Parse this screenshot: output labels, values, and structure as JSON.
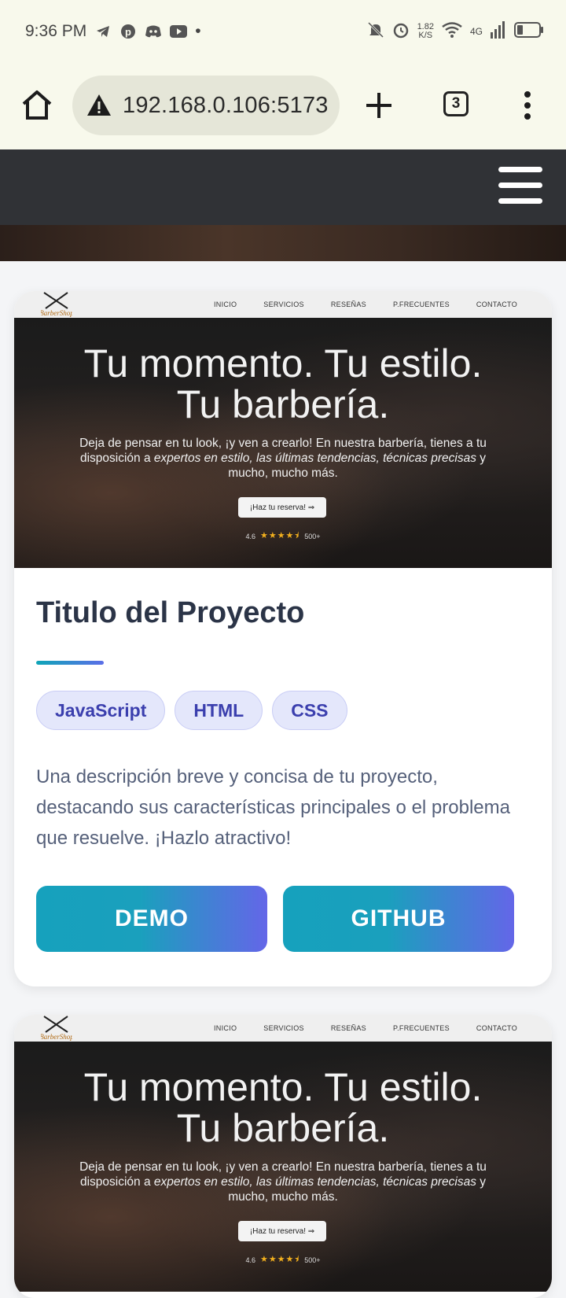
{
  "status_bar": {
    "time": "9:36 PM",
    "net_speed_value": "1.82",
    "net_speed_unit": "K/S",
    "network": "4G",
    "dot": "•"
  },
  "browser": {
    "url": "192.168.0.106:5173",
    "tab_count": "3"
  },
  "project_card": {
    "preview": {
      "nav_links": [
        "INICIO",
        "SERVICIOS",
        "RESEÑAS",
        "P.FRECUENTES",
        "CONTACTO"
      ],
      "logo_text": "BarberShop",
      "headline_line1": "Tu momento. Tu estilo.",
      "headline_line2": "Tu barbería.",
      "sub_part1": "Deja de pensar en tu look, ¡y ven a crearlo! En nuestra barbería, tienes a tu disposición a ",
      "sub_italic": "expertos en estilo, las últimas tendencias, técnicas precisas",
      "sub_part2": " y mucho, mucho más.",
      "cta": "¡Haz tu reserva! ⇒",
      "rating": "4.6",
      "stars": "★★★★⯨",
      "reviews": "500+"
    },
    "title": "Titulo del Proyecto",
    "tags": [
      "JavaScript",
      "HTML",
      "CSS"
    ],
    "description": "Una descripción breve y concisa de tu proyecto, destacando sus características principales o el problema que resuelve. ¡Hazlo atractivo!",
    "demo_label": "DEMO",
    "github_label": "GITHUB"
  },
  "colors": {
    "accent_start": "#16a1bd",
    "accent_end": "#6466e8",
    "title": "#2b3447",
    "tag_bg": "#e4e7fb",
    "tag_text": "#3b3fae",
    "nav_bg": "#303236"
  }
}
